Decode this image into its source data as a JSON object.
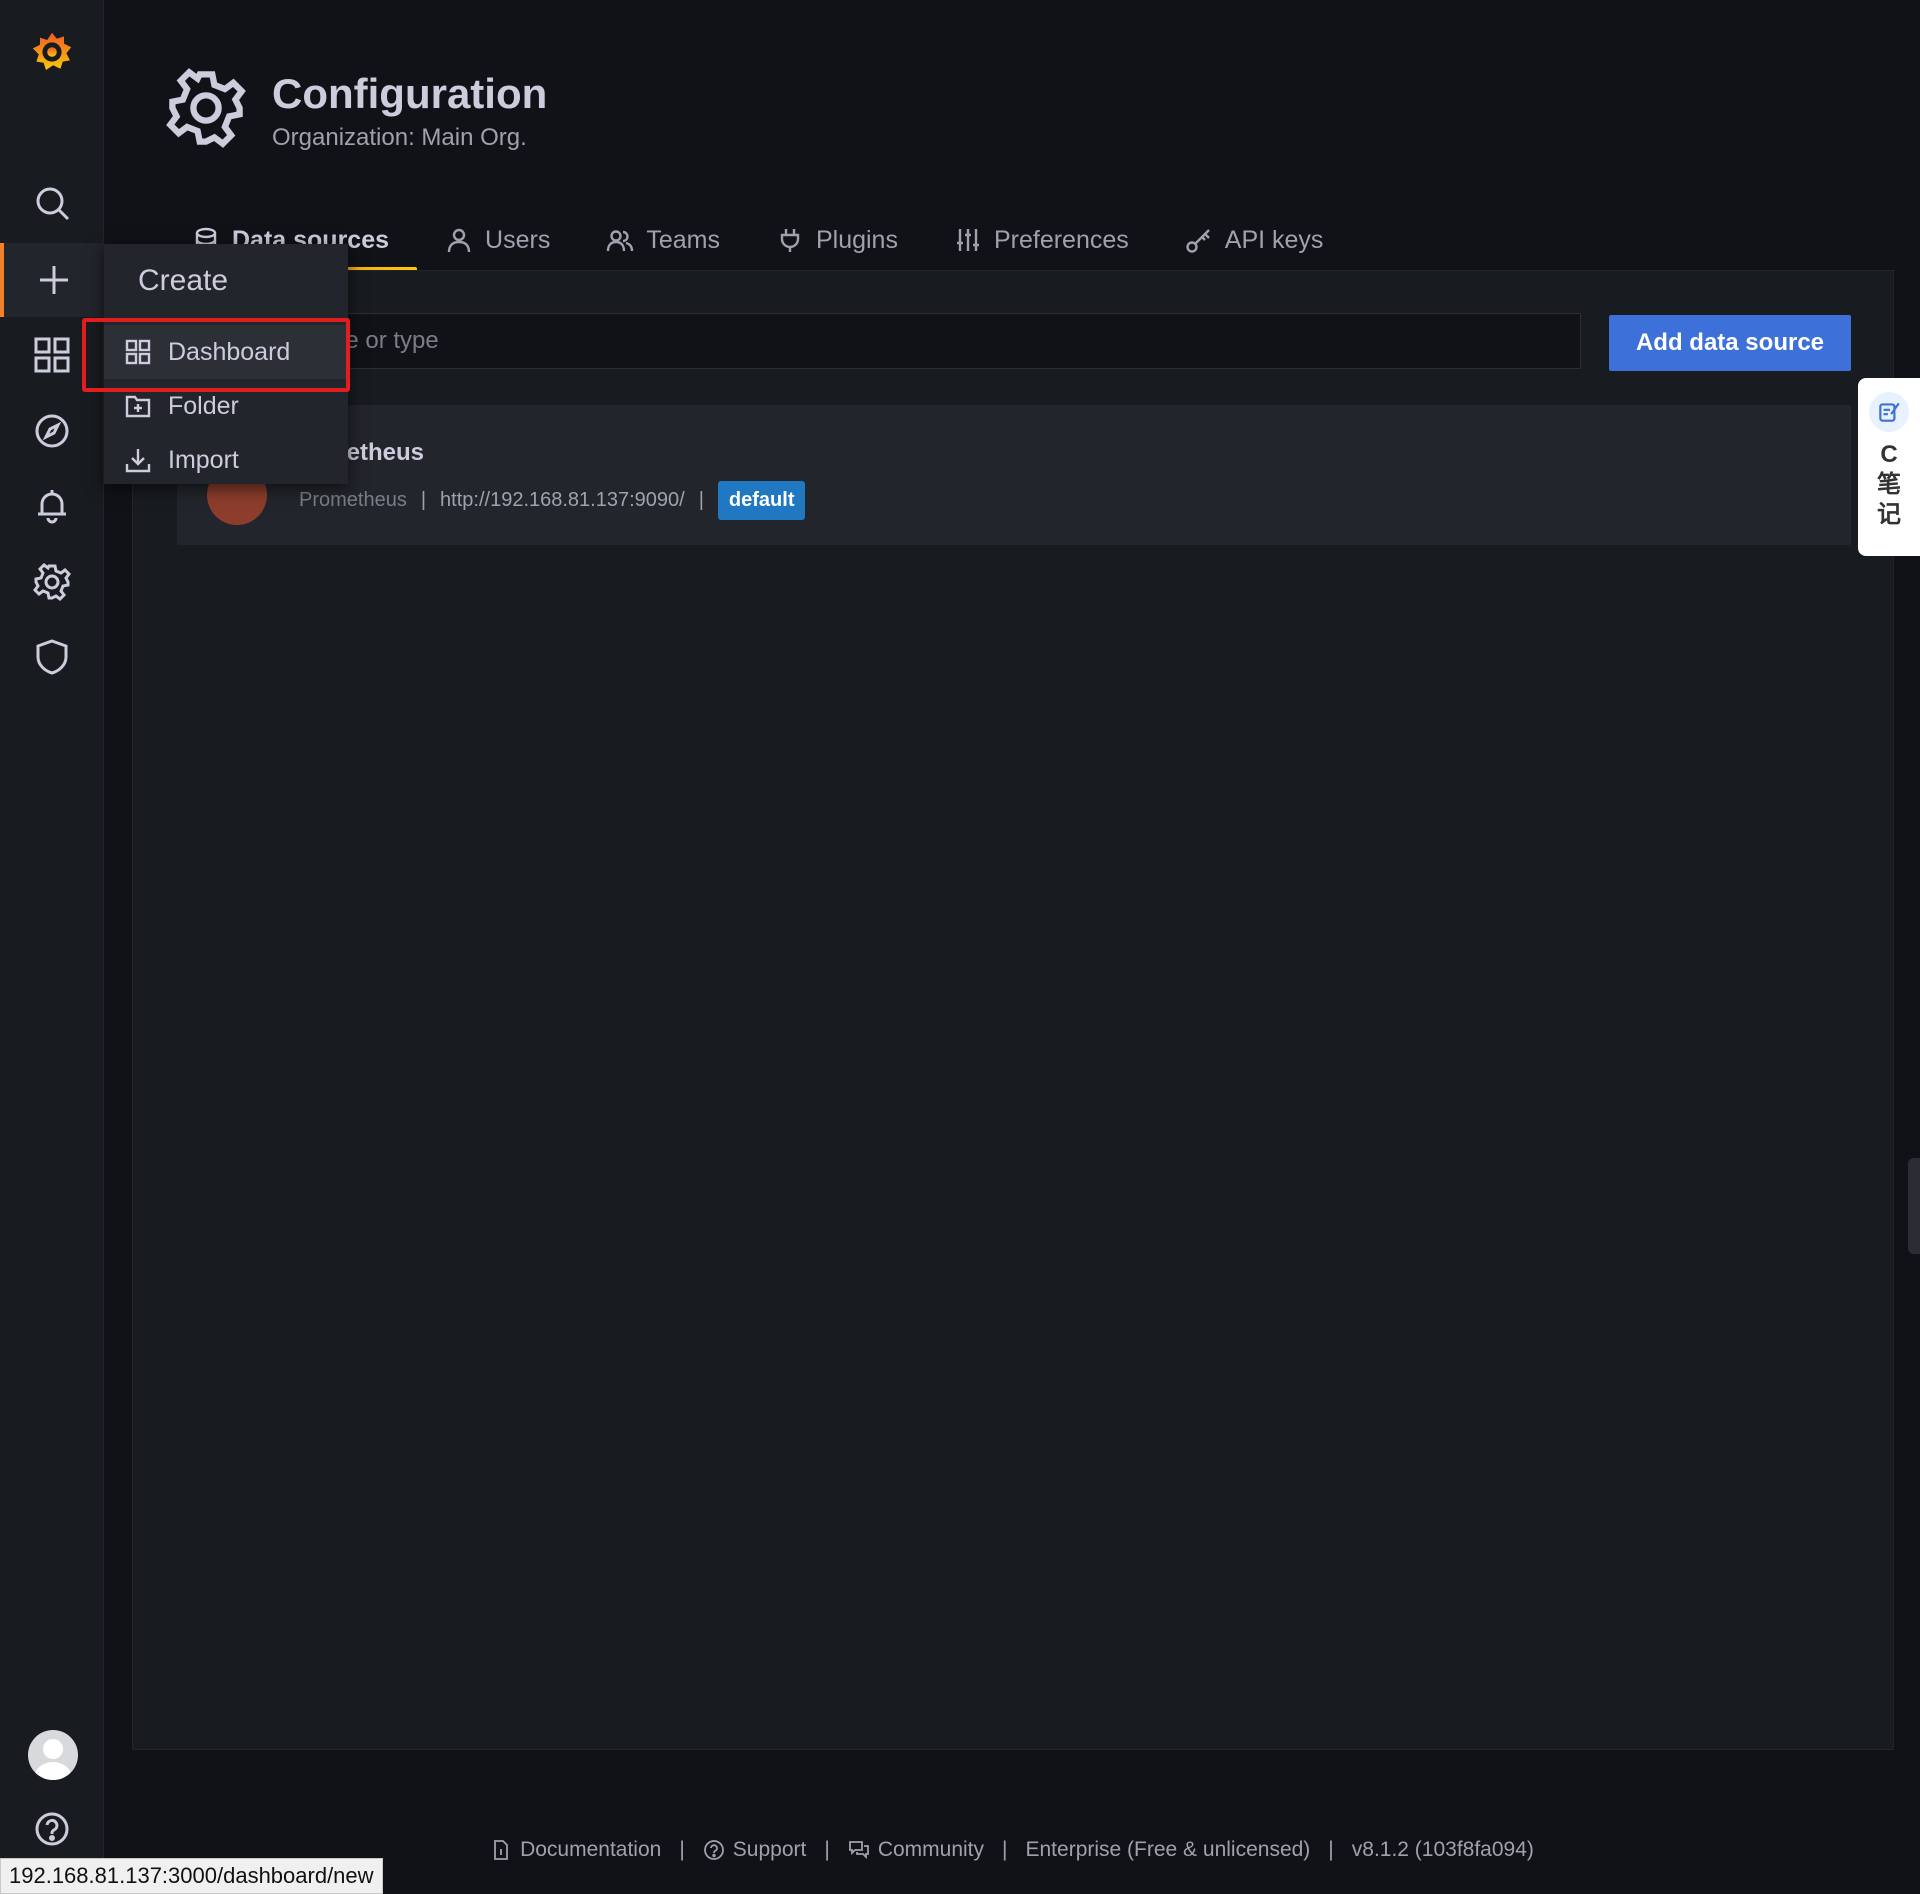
{
  "header": {
    "title": "Configuration",
    "subtitle": "Organization: Main Org."
  },
  "tabs": [
    {
      "label": "Data sources",
      "icon": "database-icon",
      "active": true
    },
    {
      "label": "Users",
      "icon": "user-icon"
    },
    {
      "label": "Teams",
      "icon": "users-icon"
    },
    {
      "label": "Plugins",
      "icon": "plug-icon"
    },
    {
      "label": "Preferences",
      "icon": "sliders-icon"
    },
    {
      "label": "API keys",
      "icon": "key-icon"
    }
  ],
  "search": {
    "placeholder": "Search by name or type",
    "visible_text": "ame or type"
  },
  "add_button": "Add data source",
  "datasource": {
    "name": "Prometheus",
    "visible_name": "netheus",
    "type": "Prometheus",
    "url": "http://192.168.81.137:9090/",
    "badge": "default"
  },
  "create_menu": {
    "header": "Create",
    "items": [
      {
        "label": "Dashboard",
        "icon": "apps-icon"
      },
      {
        "label": "Folder",
        "icon": "folder-plus-icon"
      },
      {
        "label": "Import",
        "icon": "import-icon"
      }
    ]
  },
  "side_widget": {
    "text": "C笔记"
  },
  "footer": {
    "documentation": "Documentation",
    "support": "Support",
    "community": "Community",
    "edition": "Enterprise (Free & unlicensed)",
    "version": "v8.1.2 (103f8fa094)",
    "separator": "|"
  },
  "status_url": "192.168.81.137:3000/dashboard/new",
  "colors": {
    "accent": "#f0802a",
    "primary_button": "#3d71d9",
    "badge": "#1f78c1",
    "highlight": "#e21d1d"
  }
}
